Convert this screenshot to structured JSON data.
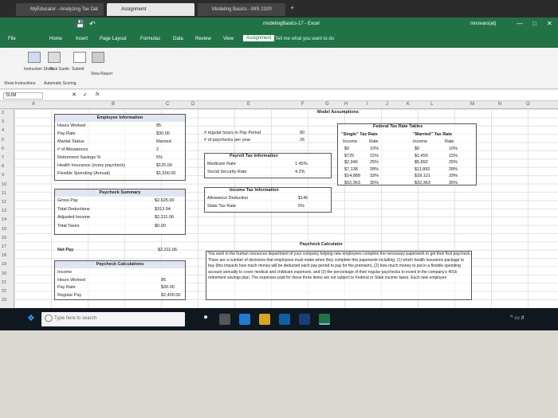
{
  "browser": {
    "tabs": [
      {
        "label": "MyEducator - Analyzing Tax Dat"
      },
      {
        "label": "Assignment"
      },
      {
        "label": "Modeling Basics - MIS 2100"
      }
    ],
    "new_tab": "+"
  },
  "window": {
    "title": "modelingBasics-17 - Excel",
    "user": "mnovaro(at)"
  },
  "ribbon": {
    "tabs": [
      "File",
      "Home",
      "Insert",
      "Page Layout",
      "Formulas",
      "Data",
      "Review",
      "View",
      "Assignment"
    ],
    "tell_me": "Tell me what you want to do",
    "buttons": [
      {
        "label": "Instruction Sheet"
      },
      {
        "label": "Task Guide"
      },
      {
        "label": "Submit"
      },
      {
        "label": "View Report"
      }
    ],
    "group_labels": [
      "Show Instructions",
      "Automatic Scoring"
    ]
  },
  "formula_bar": {
    "name_box": "SUM",
    "fx": "fx",
    "value": ""
  },
  "columns": [
    "A",
    "B",
    "C",
    "D",
    "E",
    "F",
    "G",
    "H",
    "I",
    "J",
    "K",
    "L",
    "M",
    "N",
    "O"
  ],
  "rows": [
    "2",
    "3",
    "4",
    "5",
    "6",
    "7",
    "8",
    "9",
    "10",
    "11",
    "12",
    "13",
    "14",
    "15",
    "16",
    "17",
    "18",
    "19",
    "20",
    "21",
    "22",
    "23"
  ],
  "model_title": "Model Assumptions",
  "employee": {
    "title": "Employee Information",
    "rows": [
      {
        "label": "Hours Worked",
        "value": "85"
      },
      {
        "label": "Pay Rate",
        "value": "$30.00"
      },
      {
        "label": "Marital Status",
        "value": "Married"
      },
      {
        "label": "# of Allowances",
        "value": "2"
      },
      {
        "label": "Retirement Savings %",
        "value": "5%"
      },
      {
        "label": "Health Insurance (every paycheck)",
        "value": "$125.00"
      },
      {
        "label": "Flexible Spending (Annual)",
        "value": "$1,500.00"
      }
    ]
  },
  "pay_period": {
    "rows": [
      {
        "label": "# regular hours in Pay Period",
        "value": "80"
      },
      {
        "label": "# of paychecks per year",
        "value": "26"
      }
    ]
  },
  "payroll": {
    "title": "Payroll Tax Information",
    "rows": [
      {
        "label": "Medicare Rate",
        "value": "1.45%"
      },
      {
        "label": "Social Security Rate",
        "value": "4.2%"
      }
    ]
  },
  "income_tax": {
    "title": "Income Tax Information",
    "rows": [
      {
        "label": "Allowance Deduction",
        "value": "$146"
      },
      {
        "label": "State Tax Rate",
        "value": "5%"
      }
    ]
  },
  "federal": {
    "title": "Federal Tax Rate Tables",
    "single_label": "\"Single\" Tax Rate",
    "married_label": "\"Married\" Tax Rate",
    "col_income": "Income",
    "col_rate": "Rate",
    "single": [
      [
        "$0",
        "10%"
      ],
      [
        "$725",
        "15%"
      ],
      [
        "$2,946",
        "25%"
      ],
      [
        "$7,138",
        "28%"
      ],
      [
        "$14,888",
        "33%"
      ],
      [
        "$32,363",
        "35%"
      ]
    ],
    "married": [
      [
        "$0",
        "10%"
      ],
      [
        "$1,450",
        "15%"
      ],
      [
        "$5,892",
        "25%"
      ],
      [
        "$11,892",
        "28%"
      ],
      [
        "$18,121",
        "33%"
      ],
      [
        "$32,363",
        "35%"
      ]
    ]
  },
  "summary": {
    "title": "Paycheck Summary",
    "rows": [
      {
        "label": "Gross Pay",
        "value": "$2,625.00"
      },
      {
        "label": "Total Deductions",
        "value": "$313.94"
      },
      {
        "label": "Adjusted Income",
        "value": "$2,311.06"
      },
      {
        "label": "Total Taxes",
        "value": "$0.00"
      }
    ],
    "net_label": "Net Pay",
    "net_value": "$2,311.06"
  },
  "calc": {
    "title": "Paycheck Calculations",
    "rows": [
      {
        "label": "Income",
        "value": ""
      },
      {
        "label": "Hours Worked",
        "value": "85"
      },
      {
        "label": "Pay Rate",
        "value": "$30.00"
      },
      {
        "label": "Regular Pay",
        "value": "$2,400.00"
      }
    ]
  },
  "calculator": {
    "title": "Paycheck Calculator",
    "text": "You work in the human resources department of your company helping new employees complete the necessary paperwork to get their first paycheck. There are a number of decisions that employees must make when they complete this paperwork including: (1) which health insurance package to buy (this impacts how much money will be deducted each pay period to pay for the premium), (2) how much money to put in a flexible spending account annually to cover medical and childcare expenses, and (3) the percentage of their regular paychecks to invest in the company's 401k retirement savings plan. The expenses paid for these three items are not subject to Federal or State income taxes. Each new employee"
  },
  "taskbar": {
    "search_placeholder": "Type here to search"
  }
}
